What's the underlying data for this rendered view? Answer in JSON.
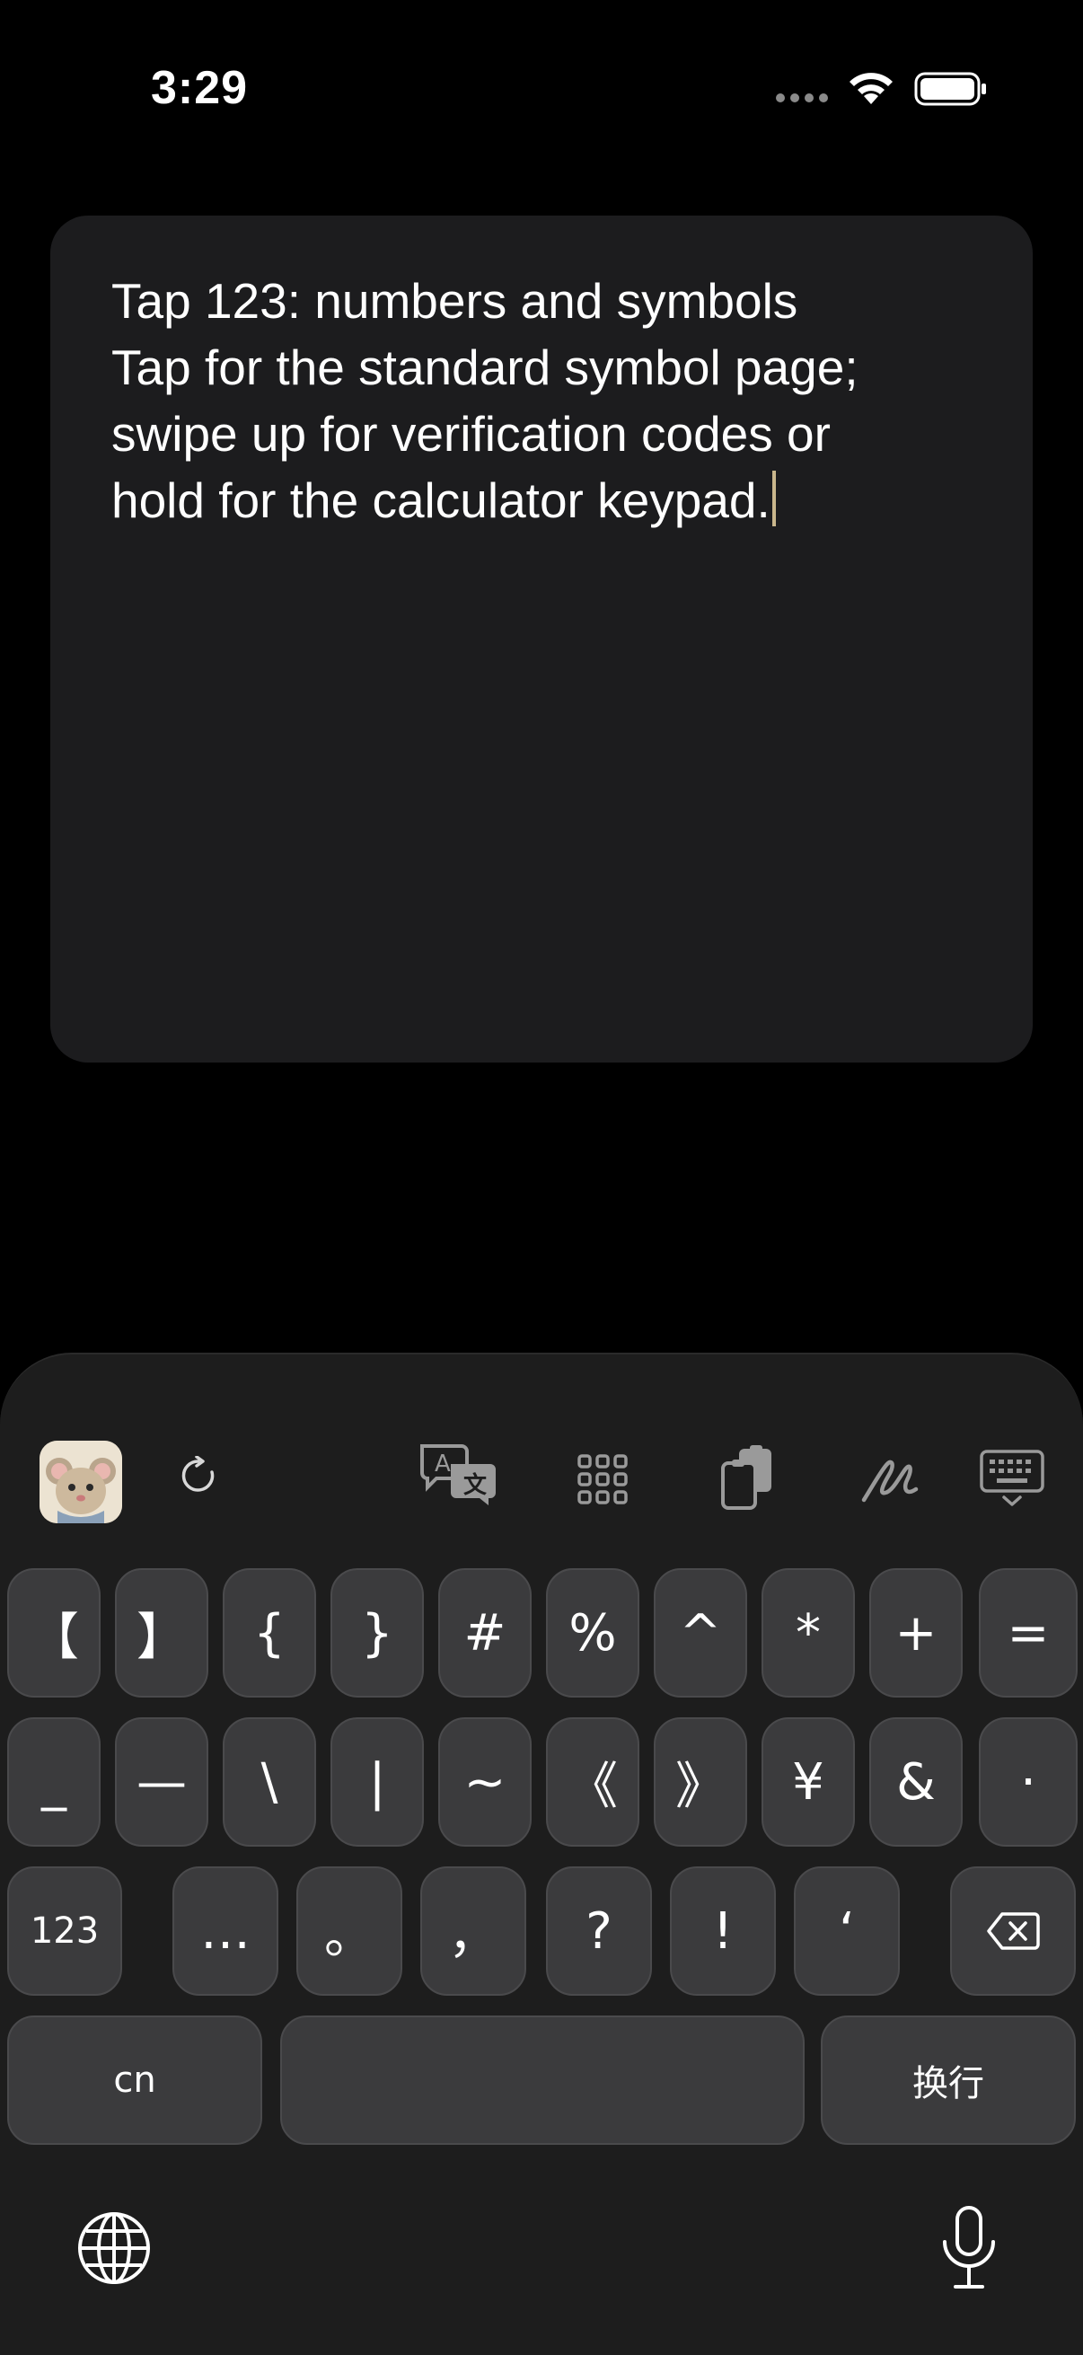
{
  "status": {
    "time": "3:29"
  },
  "note": {
    "lines": [
      "Tap 123: numbers and symbols",
      "Tap for the standard symbol page;",
      "swipe up for verification codes or",
      "hold for the calculator keypad."
    ]
  },
  "keyboard": {
    "row1": [
      "【",
      "】",
      "{",
      "}",
      "#",
      "%",
      "^",
      "*",
      "+",
      "="
    ],
    "row2": [
      "_",
      "—",
      "\\",
      "|",
      "~",
      "《",
      "》",
      "¥",
      "&",
      "·"
    ],
    "row3": [
      "123",
      "…",
      "。",
      "，",
      "?",
      "!",
      "‘"
    ],
    "row4": {
      "lang": "cn",
      "space": "",
      "return": "换行"
    },
    "toolbar_icons": [
      "app-avatar",
      "refresh-icon",
      "translate-icon",
      "grid-apps-icon",
      "clipboard-icon",
      "handwriting-icon",
      "keyboard-hide-icon"
    ],
    "bottom_icons": [
      "globe-icon",
      "microphone-icon"
    ]
  },
  "colors": {
    "background": "#000000",
    "card": "#1c1c1e",
    "key": "#3b3b3d",
    "keyboard": "#1d1d1d",
    "caret": "#c9b68c"
  }
}
